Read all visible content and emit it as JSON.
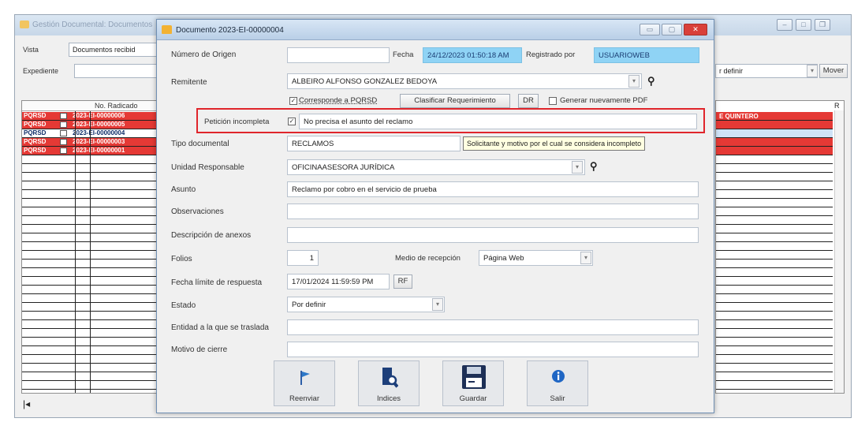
{
  "background_window": {
    "title": "Gestión Documental: Documentos",
    "vista_label": "Vista",
    "vista_value": "Documentos recibid",
    "expediente_label": "Expediente",
    "right_combo_value": "r definir",
    "mover_button": "Mover",
    "grid_header": "No. Radicado",
    "right_header": "R",
    "right_row_text": "E QUINTERO",
    "rows": [
      {
        "type": "PQRSD",
        "radicado": "2023-EI-00000006",
        "style": "red"
      },
      {
        "type": "PQRSD",
        "radicado": "2023-EI-00000005",
        "style": "red"
      },
      {
        "type": "PQRSD",
        "radicado": "2023-EI-00000004",
        "style": "white"
      },
      {
        "type": "PQRSD",
        "radicado": "2023-EI-00000003",
        "style": "red"
      },
      {
        "type": "PQRSD",
        "radicado": "2023-EI-00000001",
        "style": "red"
      }
    ]
  },
  "dialog": {
    "title": "Documento 2023-EI-00000004",
    "numero_origen_label": "Número de Origen",
    "numero_origen_value": "",
    "fecha_label": "Fecha",
    "fecha_value": "24/12/2023 01:50:18 AM",
    "registrado_label": "Registrado por",
    "registrado_value": "USUARIOWEB",
    "remitente_label": "Remitente",
    "remitente_value": "ALBEIRO ALFONSO GONZALEZ BEDOYA",
    "corresponde_label": "Corresponde a PQRSD",
    "clasificar_button": "Clasificar Requerimiento",
    "dr_button": "DR",
    "generar_pdf_label": "Generar nuevamente PDF",
    "peticion_label": "Petición incompleta",
    "peticion_value": "No precisa el asunto del reclamo",
    "tooltip": "Solicitante y motivo por el cual se considera incompleto",
    "tipo_documental_label": "Tipo documental",
    "tipo_documental_value": "RECLAMOS",
    "unidad_label": "Unidad Responsable",
    "unidad_value": "OFICINAASESORA JURÍDICA",
    "asunto_label": "Asunto",
    "asunto_value": "Reclamo por cobro en el servicio de prueba",
    "observaciones_label": "Observaciones",
    "observaciones_value": "",
    "anexos_label": "Descripción de anexos",
    "anexos_value": "",
    "folios_label": "Folios",
    "folios_value": "1",
    "medio_label": "Medio de recepción",
    "medio_value": "Página Web",
    "fecha_limite_label": "Fecha límite de respuesta",
    "fecha_limite_value": "17/01/2024 11:59:59 PM",
    "rf_button": "RF",
    "estado_label": "Estado",
    "estado_value": "Por definir",
    "entidad_label": "Entidad a la que se traslada",
    "entidad_value": "",
    "motivo_label": "Motivo de cierre",
    "motivo_value": "",
    "buttons": {
      "reenviar": "Reenviar",
      "indices": "Indices",
      "guardar": "Guardar",
      "salir": "Salir"
    }
  },
  "colors": {
    "highlight_red": "#e0252b",
    "row_red": "#e53935",
    "date_field_blue": "#8fd3f5"
  }
}
